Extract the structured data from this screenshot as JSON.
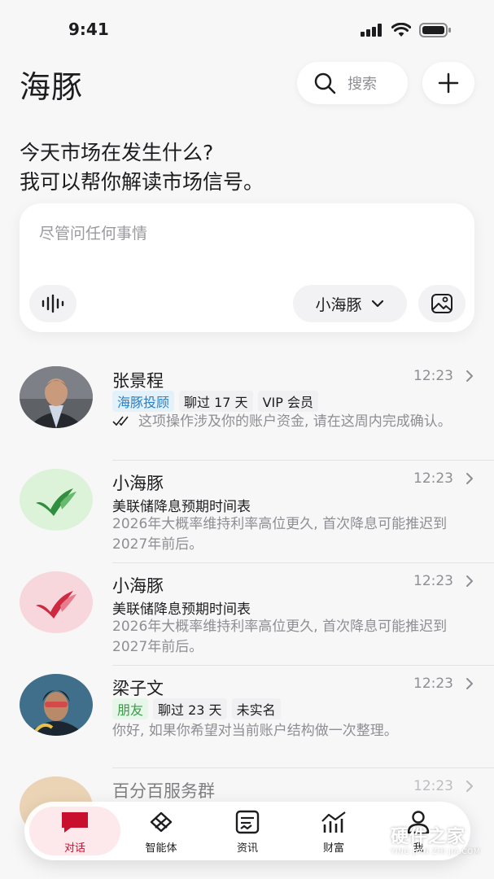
{
  "status_bar": {
    "time": "9:41"
  },
  "header": {
    "title": "海豚",
    "search_label": "搜索"
  },
  "greeting": {
    "line1": "今天市场在发生什么?",
    "line2": "我可以帮你解读市场信号。"
  },
  "ask": {
    "placeholder": "尽管问任何事情",
    "model": "小海豚"
  },
  "chats": [
    {
      "name": "张景程",
      "time": "12:23",
      "tags": [
        "海豚投顾",
        "聊过 17 天",
        "VIP 会员"
      ],
      "preview": "这项操作涉及你的账户资金, 请在这周内完成确认。"
    },
    {
      "name": "小海豚",
      "time": "12:23",
      "subtitle": "美联储降息预期时间表",
      "preview": "2026年大概率维持利率高位更久, 首次降息可能推迟到2027年前后。",
      "accent": "#3aa84a"
    },
    {
      "name": "小海豚",
      "time": "12:23",
      "subtitle": "美联储降息预期时间表",
      "preview": "2026年大概率维持利率高位更久, 首次降息可能推迟到2027年前后。",
      "accent": "#d2304a"
    },
    {
      "name": "梁子文",
      "time": "12:23",
      "tags": [
        "朋友",
        "聊过 23 天",
        "未实名"
      ],
      "preview": "你好, 如果你希望对当前账户结构做一次整理。"
    },
    {
      "name": "百分百服务群",
      "time": "12:23"
    }
  ],
  "tabs": [
    {
      "label": "对话",
      "icon": "chat-bubble-icon",
      "active": true
    },
    {
      "label": "智能体",
      "icon": "agent-icon"
    },
    {
      "label": "资讯",
      "icon": "news-icon"
    },
    {
      "label": "财富",
      "icon": "wealth-chart-icon"
    },
    {
      "label": "我",
      "icon": "profile-icon"
    }
  ],
  "watermark": {
    "title": "硬件之家",
    "subtitle": "YING JIAN ZHI JIA.COM"
  },
  "colors": {
    "accent": "#c8102e",
    "tag_blue": "#2a7fbf",
    "tag_green": "#3a9a4a"
  }
}
